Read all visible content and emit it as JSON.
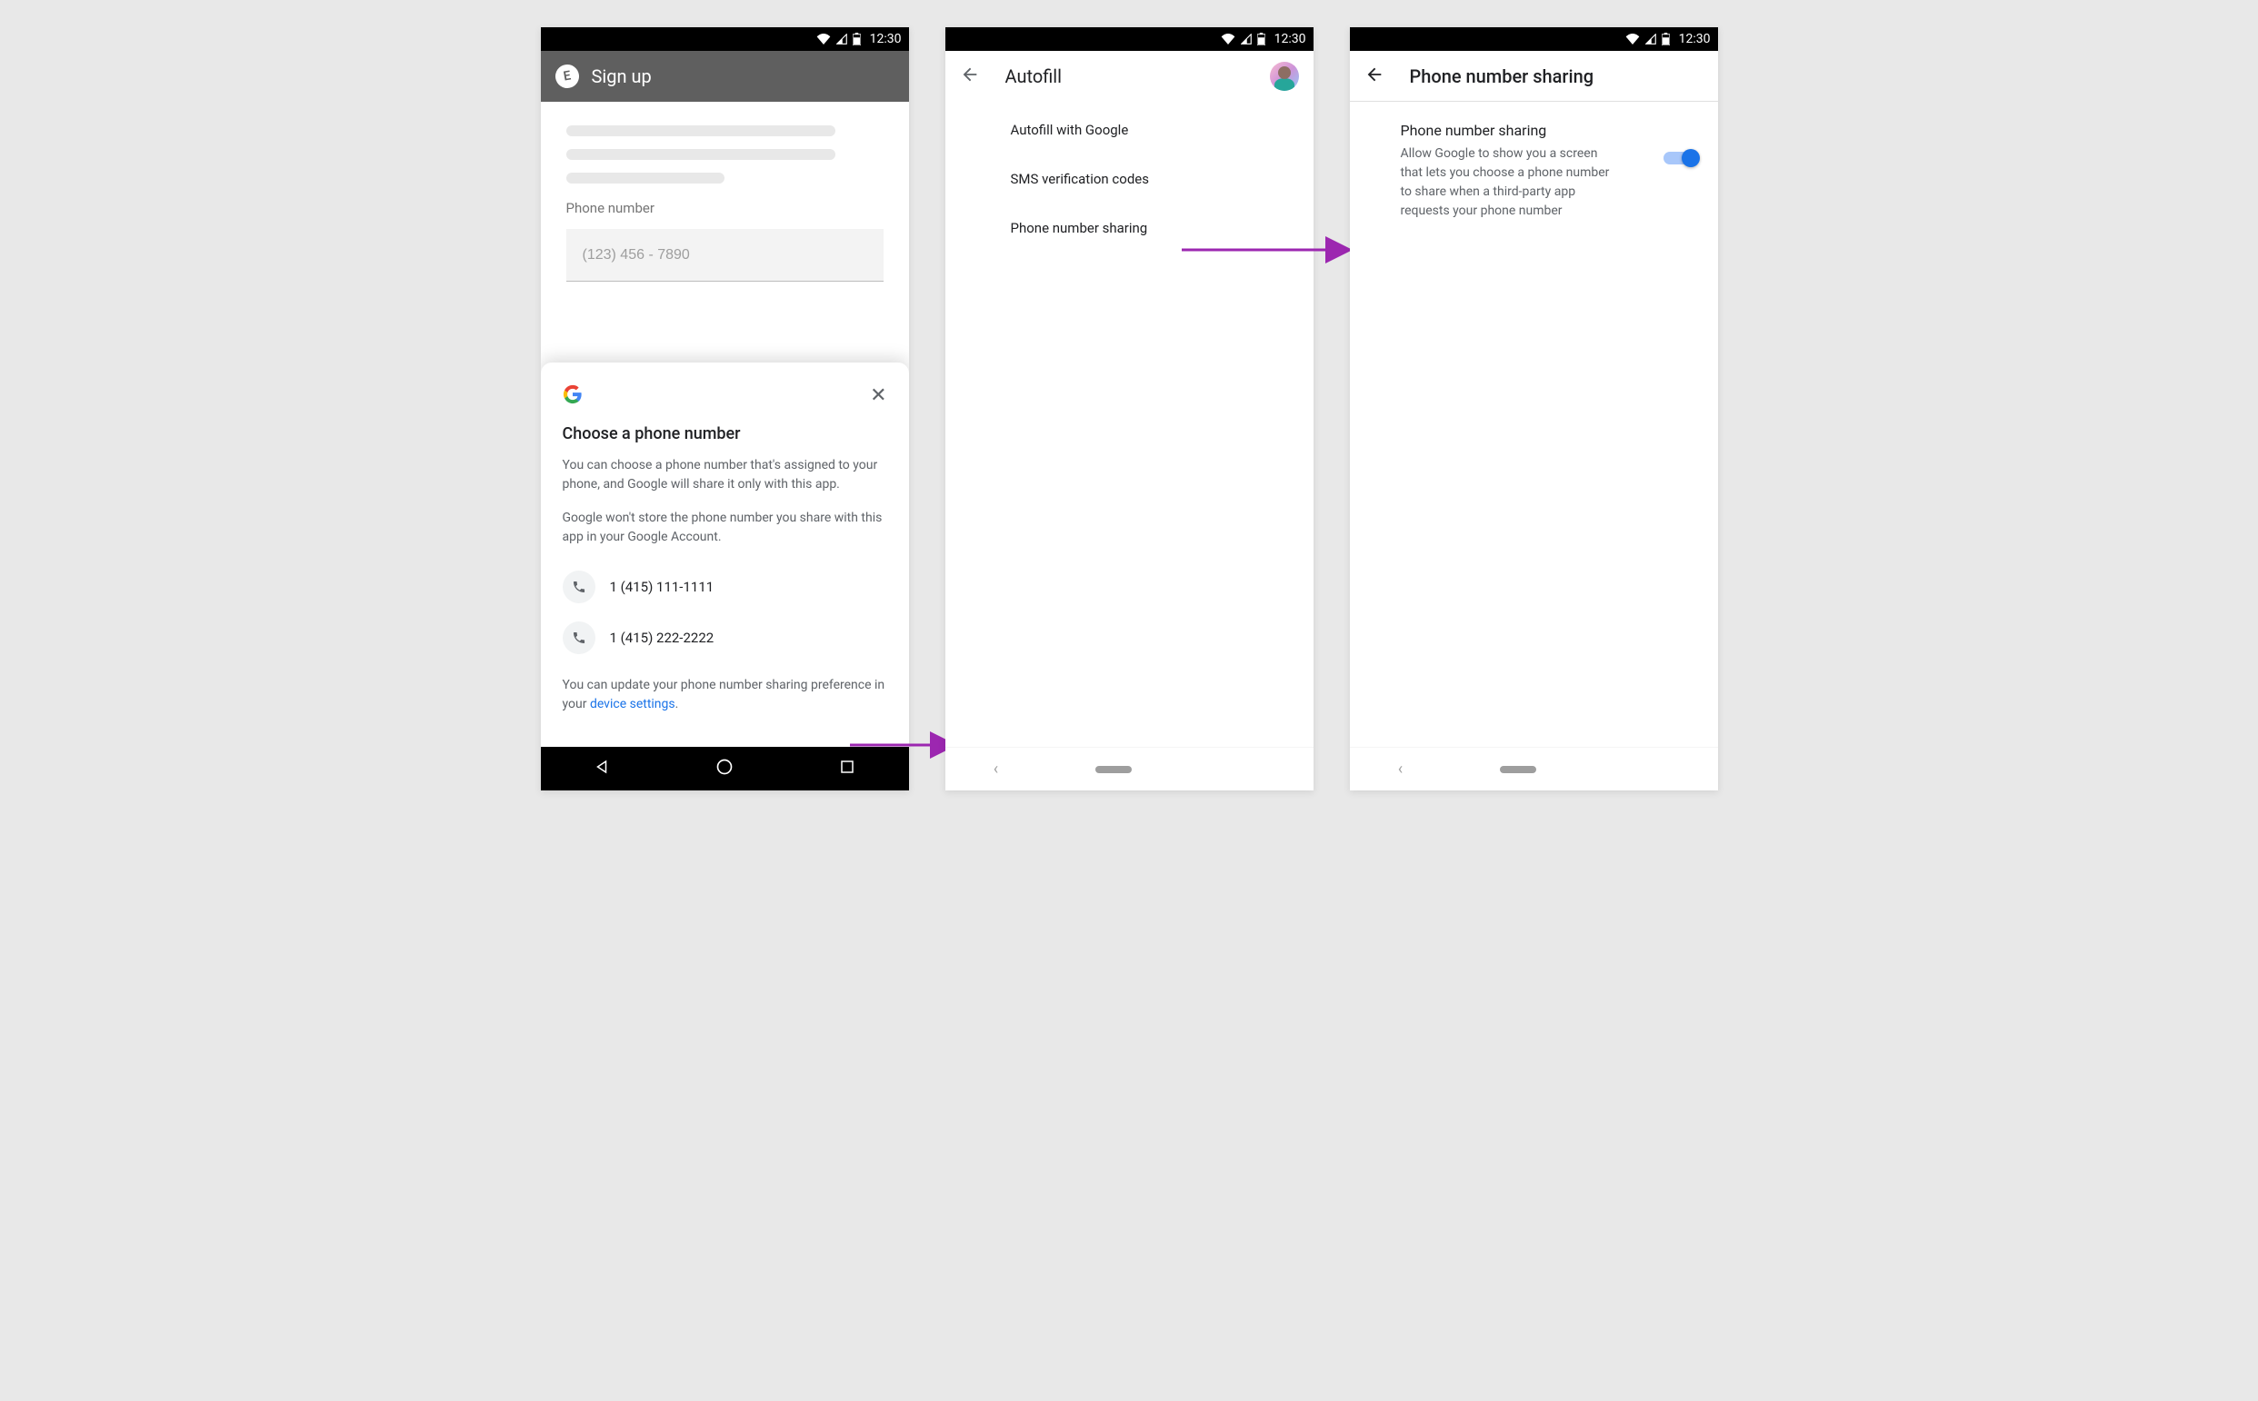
{
  "statusbar": {
    "time": "12:30"
  },
  "screen1": {
    "app_badge": "E",
    "app_title": "Sign up",
    "phone_label": "Phone number",
    "phone_placeholder": "(123) 456 - 7890",
    "sheet": {
      "title": "Choose a phone number",
      "para1": "You can choose a phone number that's assigned to your phone, and Google will share it only with this app.",
      "para2": "Google won't store the phone number you share with this app in your Google Account.",
      "numbers": [
        "1 (415) 111-1111",
        "1 (415) 222-2222"
      ],
      "note_prefix": "You can update your phone number sharing preference in your ",
      "note_link": "device settings",
      "note_suffix": "."
    }
  },
  "screen2": {
    "title": "Autofill",
    "items": [
      "Autofill with Google",
      "SMS verification codes",
      "Phone number sharing"
    ]
  },
  "screen3": {
    "title": "Phone number sharing",
    "setting_title": "Phone number sharing",
    "setting_desc": "Allow Google to show you a screen that lets you choose a phone number to share when a third-party app requests your phone number",
    "switch_on": true
  },
  "colors": {
    "accent": "#1a73e8",
    "arrow": "#9c27b0"
  }
}
